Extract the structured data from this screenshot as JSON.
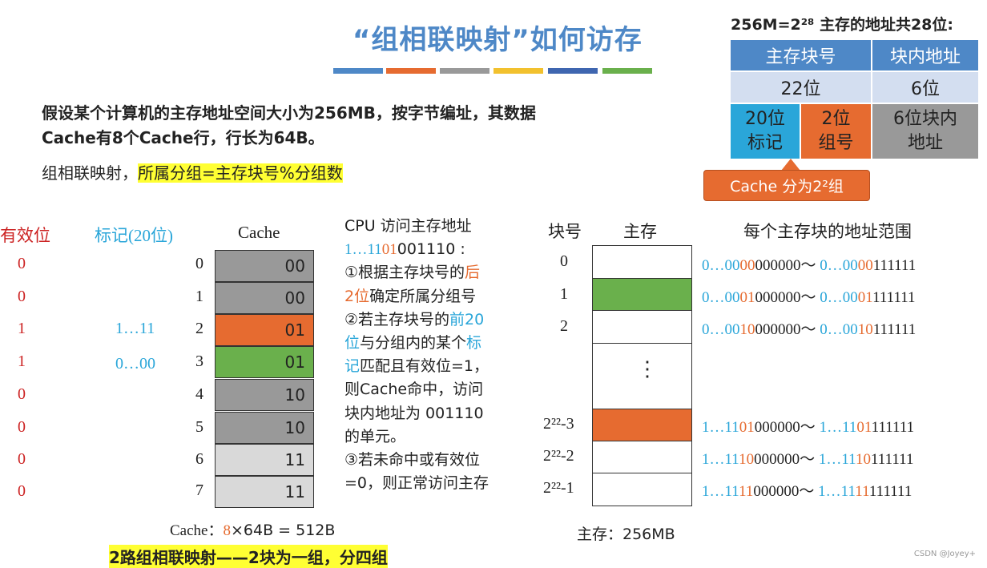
{
  "title": "“组相联映射”如何访存",
  "colors": {
    "blue": "#4e88c7",
    "orange": "#e66b30",
    "gray": "#999999",
    "yellow": "#f2c12e",
    "darkblue": "#3f66b0",
    "green": "#6ab04c"
  },
  "intro": "假设某个计算机的主存地址空间大小为256MB，按字节编址，其数据Cache有8个Cache行，行长为64B。",
  "formula": {
    "prefix": "组相联映射，",
    "highlight": "所属分组=主存块号%分组数"
  },
  "address": {
    "header": "256M=2²⁸ 主存的地址共28位:",
    "block_label": "主存块号",
    "offset_label": "块内地址",
    "block_bits": "22位",
    "offset_bits": "6位",
    "tag_cell": "20位\n标记",
    "group_cell": "2位\n组号",
    "inner_cell": "6位块内\n地址",
    "badge": "Cache 分为2²组"
  },
  "cache": {
    "valid_header": "有效位",
    "tag_header": "标记(20位)",
    "cache_header": "Cache",
    "rows": [
      {
        "index": "0",
        "valid": "0",
        "tag": "",
        "value": "00",
        "color": "#999999"
      },
      {
        "index": "1",
        "valid": "0",
        "tag": "",
        "value": "00",
        "color": "#999999"
      },
      {
        "index": "2",
        "valid": "1",
        "tag": "1…11",
        "value": "01",
        "color": "#e66b30"
      },
      {
        "index": "3",
        "valid": "1",
        "tag": "0…00",
        "value": "01",
        "color": "#6ab04c"
      },
      {
        "index": "4",
        "valid": "0",
        "tag": "",
        "value": "10",
        "color": "#999999"
      },
      {
        "index": "5",
        "valid": "0",
        "tag": "",
        "value": "10",
        "color": "#999999"
      },
      {
        "index": "6",
        "valid": "0",
        "tag": "",
        "value": "11",
        "color": "#d9d9d9"
      },
      {
        "index": "7",
        "valid": "0",
        "tag": "",
        "value": "11",
        "color": "#d9d9d9"
      }
    ],
    "size_label": "Cache：",
    "size_count": "8",
    "size_rest": "×64B = 512B"
  },
  "steps": {
    "line1": "CPU 访问主存地址",
    "addr_a": "1…11",
    "addr_b": "01",
    "addr_c": "001110 :",
    "s1a": "①根据主存块号的",
    "s1b": "后",
    "s1c": "2位",
    "s1d": "确定所属分组号",
    "s2a": "②若主存块号的",
    "s2b": "前20",
    "s2c": "位",
    "s2d": "与分组内的某个",
    "s2e": "标",
    "s2f": "记",
    "s2g": "匹配且有效位=1，",
    "s2h": "则Cache命中，访问",
    "s2i": "块内地址为 001110",
    "s2j": "的单元。",
    "s3a": "③若未命中或有效位",
    "s3b": "=0，则正常访问主存"
  },
  "memory": {
    "block_header": "块号",
    "mem_header": "主存",
    "range_header": "每个主存块的地址范围",
    "blocks": [
      "0",
      "1",
      "2",
      "2²²-3",
      "2²²-2",
      "2²²-1"
    ],
    "dots": "⋮",
    "size_label": "主存：256MB",
    "ranges": [
      {
        "a": "0…00",
        "b": "00",
        "c": "000000～ ",
        "d": "0…00",
        "e": "00",
        "f": "111111"
      },
      {
        "a": "0…00",
        "b": "01",
        "c": "000000～ ",
        "d": "0…00",
        "e": "01",
        "f": "111111"
      },
      {
        "a": "0…00",
        "b": "10",
        "c": "000000～ ",
        "d": "0…00",
        "e": "10",
        "f": "111111"
      },
      {
        "a": "1…11",
        "b": "01",
        "c": "000000～ ",
        "d": "1…11",
        "e": "01",
        "f": "111111"
      },
      {
        "a": "1…11",
        "b": "10",
        "c": "000000～ ",
        "d": "1…11",
        "e": "10",
        "f": "111111"
      },
      {
        "a": "1…11",
        "b": "11",
        "c": "000000～ ",
        "d": "1…11",
        "e": "11",
        "f": "111111"
      }
    ]
  },
  "bottom": "2路组相联映射——2块为一组，分四组",
  "watermark": "CSDN @Joyey+"
}
